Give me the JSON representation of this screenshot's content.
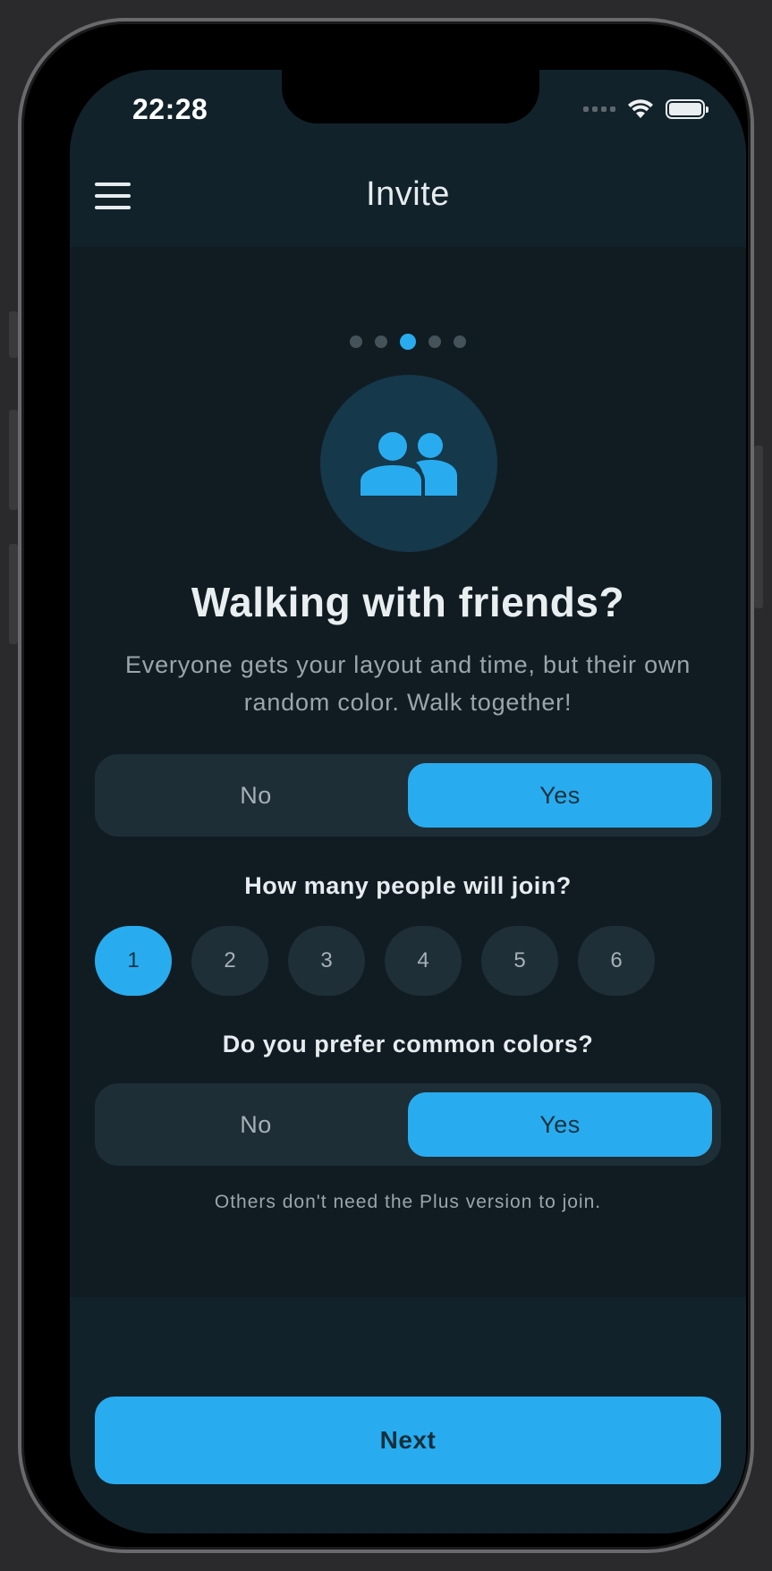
{
  "status_bar": {
    "time": "22:28",
    "icons": [
      "cellular-signal-icon",
      "wifi-icon",
      "battery-icon"
    ]
  },
  "header": {
    "menu_icon": "hamburger-menu-icon",
    "title": "Invite"
  },
  "pagination": {
    "total": 5,
    "current": 3
  },
  "hero_icon": "group-people-icon",
  "title": "Walking with friends?",
  "subtitle": "Everyone gets your layout and time, but their own random color. Walk together!",
  "invite_toggle": {
    "options": [
      "No",
      "Yes"
    ],
    "selected": "Yes"
  },
  "people_question": "How many people will join?",
  "people_options": {
    "values": [
      "1",
      "2",
      "3",
      "4",
      "5",
      "6"
    ],
    "selected": "1"
  },
  "colors_question": "Do you prefer common colors?",
  "colors_toggle": {
    "options": [
      "No",
      "Yes"
    ],
    "selected": "Yes"
  },
  "note": "Others don't need the Plus version to join.",
  "next_button": "Next",
  "colors": {
    "accent": "#29acef",
    "background": "#111c22",
    "header_background": "#12222a",
    "surface": "#1d2e36"
  }
}
